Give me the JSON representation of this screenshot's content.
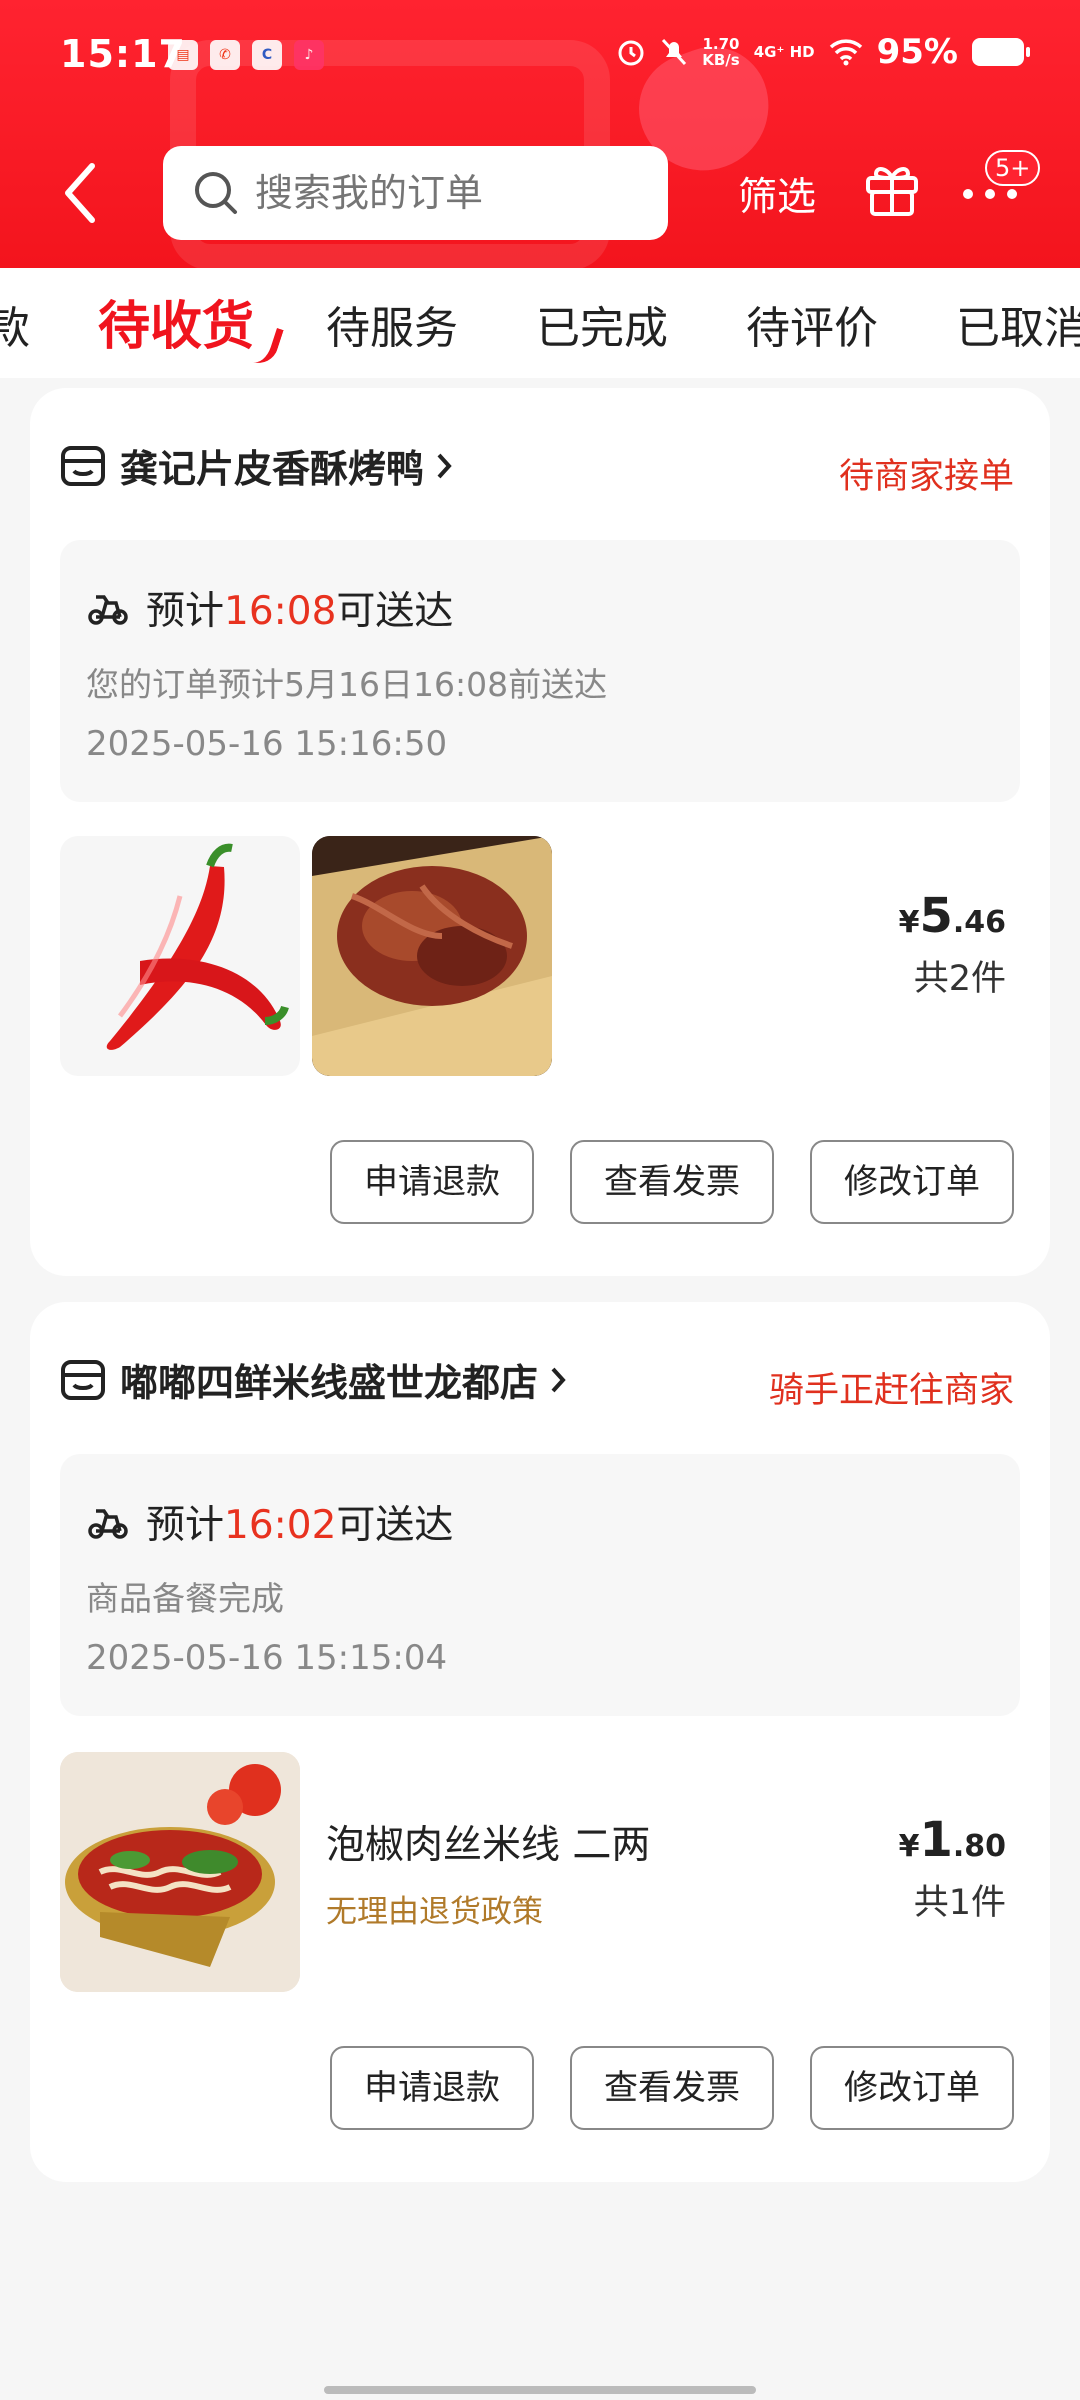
{
  "status_bar": {
    "time": "15:17",
    "speed_value": "1.70",
    "speed_unit": "KB/s",
    "network": "4G⁺ HD",
    "battery": "95%"
  },
  "header": {
    "search_placeholder": "搜索我的订单",
    "filter_label": "筛选",
    "badge": "5+"
  },
  "tabs": [
    {
      "label": "款"
    },
    {
      "label": "待收货"
    },
    {
      "label": "待服务"
    },
    {
      "label": "已完成"
    },
    {
      "label": "待评价"
    },
    {
      "label": "已取消"
    }
  ],
  "orders": [
    {
      "store": "龚记片皮香酥烤鸭",
      "status": "待商家接单",
      "eta_prefix": "预计",
      "eta_time": "16:08",
      "eta_suffix": "可送达",
      "detail": "您的订单预计5月16日16:08前送达",
      "timestamp": "2025-05-16 15:16:50",
      "price_yen": "¥",
      "price_int": "5",
      "price_dec": ".46",
      "qty": "共2件",
      "buttons": [
        "申请退款",
        "查看发票",
        "修改订单"
      ]
    },
    {
      "store": "嘟嘟四鲜米线盛世龙都店",
      "status": "骑手正赶往商家",
      "eta_prefix": "预计",
      "eta_time": "16:02",
      "eta_suffix": "可送达",
      "detail": "商品备餐完成",
      "timestamp": "2025-05-16 15:15:04",
      "item_name": "泡椒肉丝米线 二两",
      "item_policy": "无理由退货政策",
      "price_yen": "¥",
      "price_int": "1",
      "price_dec": ".80",
      "qty": "共1件",
      "buttons": [
        "申请退款",
        "查看发票",
        "修改订单"
      ]
    }
  ]
}
